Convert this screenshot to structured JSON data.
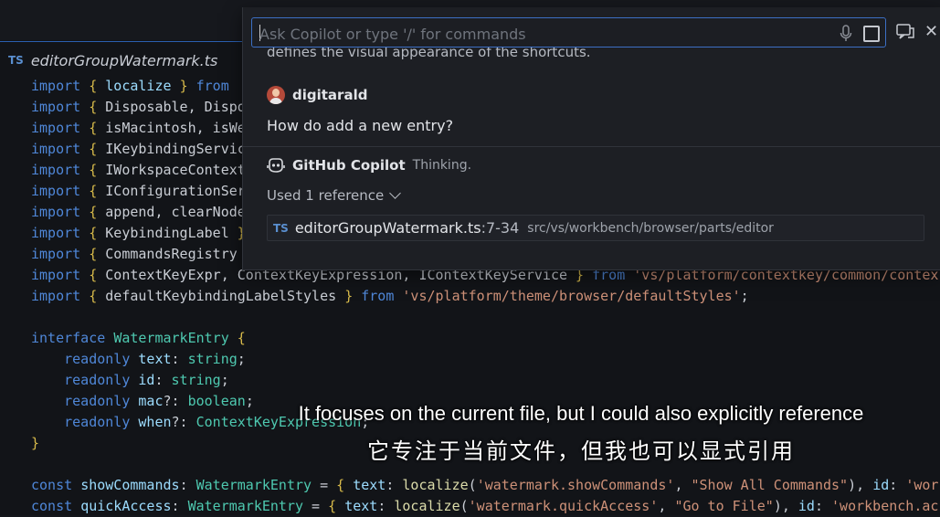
{
  "editor": {
    "tab": {
      "lang_badge": "TS",
      "filename": "editorGroupWatermark.ts"
    },
    "lines": [
      [
        [
          "kw",
          "import"
        ],
        [
          "pn",
          " "
        ],
        [
          "br",
          "{"
        ],
        [
          "pn",
          " "
        ],
        [
          "id",
          "localize"
        ],
        [
          "pn",
          " "
        ],
        [
          "br",
          "}"
        ],
        [
          "pn",
          " "
        ],
        [
          "kw",
          "from"
        ]
      ],
      [
        [
          "kw",
          "import"
        ],
        [
          "pn",
          " "
        ],
        [
          "br",
          "{"
        ],
        [
          "pn",
          " Disposable, Dispo"
        ]
      ],
      [
        [
          "kw",
          "import"
        ],
        [
          "pn",
          " "
        ],
        [
          "br",
          "{"
        ],
        [
          "pn",
          " isMacintosh, isWe"
        ]
      ],
      [
        [
          "kw",
          "import"
        ],
        [
          "pn",
          " "
        ],
        [
          "br",
          "{"
        ],
        [
          "pn",
          " IKeybindingServic"
        ]
      ],
      [
        [
          "kw",
          "import"
        ],
        [
          "pn",
          " "
        ],
        [
          "br",
          "{"
        ],
        [
          "pn",
          " IWorkspaceContext"
        ]
      ],
      [
        [
          "kw",
          "import"
        ],
        [
          "pn",
          " "
        ],
        [
          "br",
          "{"
        ],
        [
          "pn",
          " IConfigurationSer"
        ]
      ],
      [
        [
          "kw",
          "import"
        ],
        [
          "pn",
          " "
        ],
        [
          "br",
          "{"
        ],
        [
          "pn",
          " append, clearNode"
        ]
      ],
      [
        [
          "kw",
          "import"
        ],
        [
          "pn",
          " "
        ],
        [
          "br",
          "{"
        ],
        [
          "pn",
          " KeybindingLabel "
        ],
        [
          "br",
          "}"
        ]
      ],
      [
        [
          "kw",
          "import"
        ],
        [
          "pn",
          " "
        ],
        [
          "br",
          "{"
        ],
        [
          "pn",
          " CommandsRegistry "
        ]
      ],
      [
        [
          "kw",
          "import"
        ],
        [
          "pn",
          " "
        ],
        [
          "br",
          "{"
        ],
        [
          "pn",
          " ContextKeyExpr, ContextKeyExpression, IContextKeyService "
        ],
        [
          "br",
          "}"
        ],
        [
          "pn",
          " "
        ],
        [
          "kw",
          "from"
        ],
        [
          "pn",
          " "
        ],
        [
          "st",
          "'vs/platform/contextkey/common/contex"
        ]
      ],
      [
        [
          "kw",
          "import"
        ],
        [
          "pn",
          " "
        ],
        [
          "br",
          "{"
        ],
        [
          "pn",
          " defaultKeybindingLabelStyles "
        ],
        [
          "br",
          "}"
        ],
        [
          "pn",
          " "
        ],
        [
          "kw",
          "from"
        ],
        [
          "pn",
          " "
        ],
        [
          "st",
          "'vs/platform/theme/browser/defaultStyles'"
        ],
        [
          "pn",
          ";"
        ]
      ],
      [],
      [
        [
          "kw",
          "interface"
        ],
        [
          "pn",
          " "
        ],
        [
          "ty",
          "WatermarkEntry"
        ],
        [
          "pn",
          " "
        ],
        [
          "br",
          "{"
        ]
      ],
      [
        [
          "pn",
          "    "
        ],
        [
          "kw",
          "readonly"
        ],
        [
          "pn",
          " "
        ],
        [
          "id",
          "text"
        ],
        [
          "pn",
          ": "
        ],
        [
          "ty",
          "string"
        ],
        [
          "pn",
          ";"
        ]
      ],
      [
        [
          "pn",
          "    "
        ],
        [
          "kw",
          "readonly"
        ],
        [
          "pn",
          " "
        ],
        [
          "id",
          "id"
        ],
        [
          "pn",
          ": "
        ],
        [
          "ty",
          "string"
        ],
        [
          "pn",
          ";"
        ]
      ],
      [
        [
          "pn",
          "    "
        ],
        [
          "kw",
          "readonly"
        ],
        [
          "pn",
          " "
        ],
        [
          "id",
          "mac"
        ],
        [
          "pn",
          "?: "
        ],
        [
          "ty",
          "boolean"
        ],
        [
          "pn",
          ";"
        ]
      ],
      [
        [
          "pn",
          "    "
        ],
        [
          "kw",
          "readonly"
        ],
        [
          "pn",
          " "
        ],
        [
          "id",
          "when"
        ],
        [
          "pn",
          "?: "
        ],
        [
          "ty",
          "ContextKeyExpression"
        ],
        [
          "pn",
          ";"
        ]
      ],
      [
        [
          "br",
          "}"
        ]
      ],
      [],
      [
        [
          "kw",
          "const"
        ],
        [
          "pn",
          " "
        ],
        [
          "id",
          "showCommands"
        ],
        [
          "pn",
          ": "
        ],
        [
          "ty",
          "WatermarkEntry"
        ],
        [
          "pn",
          " = "
        ],
        [
          "br",
          "{"
        ],
        [
          "pn",
          " "
        ],
        [
          "id",
          "text"
        ],
        [
          "pn",
          ": "
        ],
        [
          "fn",
          "localize"
        ],
        [
          "pn",
          "("
        ],
        [
          "st",
          "'watermark.showCommands'"
        ],
        [
          "pn",
          ", "
        ],
        [
          "st",
          "\"Show All Commands\""
        ],
        [
          "pn",
          "), "
        ],
        [
          "id",
          "id"
        ],
        [
          "pn",
          ": "
        ],
        [
          "st",
          "'wor"
        ]
      ],
      [
        [
          "kw",
          "const"
        ],
        [
          "pn",
          " "
        ],
        [
          "id",
          "quickAccess"
        ],
        [
          "pn",
          ": "
        ],
        [
          "ty",
          "WatermarkEntry"
        ],
        [
          "pn",
          " = "
        ],
        [
          "br",
          "{"
        ],
        [
          "pn",
          " "
        ],
        [
          "id",
          "text"
        ],
        [
          "pn",
          ": "
        ],
        [
          "fn",
          "localize"
        ],
        [
          "pn",
          "("
        ],
        [
          "st",
          "'watermark.quickAccess'"
        ],
        [
          "pn",
          ", "
        ],
        [
          "st",
          "\"Go to File\""
        ],
        [
          "pn",
          "), "
        ],
        [
          "id",
          "id"
        ],
        [
          "pn",
          ": "
        ],
        [
          "st",
          "'workbench.ac"
        ]
      ]
    ]
  },
  "chat": {
    "input": {
      "placeholder": "Ask Copilot or type '/' for commands"
    },
    "previous_text": "defines the visual appearance of the shortcuts.",
    "user": {
      "name": "digitarald",
      "message": "How do add a new entry?"
    },
    "assistant": {
      "name": "GitHub Copilot",
      "status": "Thinking."
    },
    "references": {
      "label": "Used 1 reference",
      "items": [
        {
          "badge": "TS",
          "file": "editorGroupWatermark.ts",
          "range": ":7-34",
          "path": "src/vs/workbench/browser/parts/editor"
        }
      ]
    },
    "icons": [
      "mic-icon",
      "stop-icon",
      "open-in-chat-view-icon",
      "close-icon",
      "copilot-icon"
    ]
  },
  "subtitles": {
    "english": "It focuses on the current file, but I could also explicitly reference",
    "chinese": "它专注于当前文件，但我也可以显式引用"
  }
}
